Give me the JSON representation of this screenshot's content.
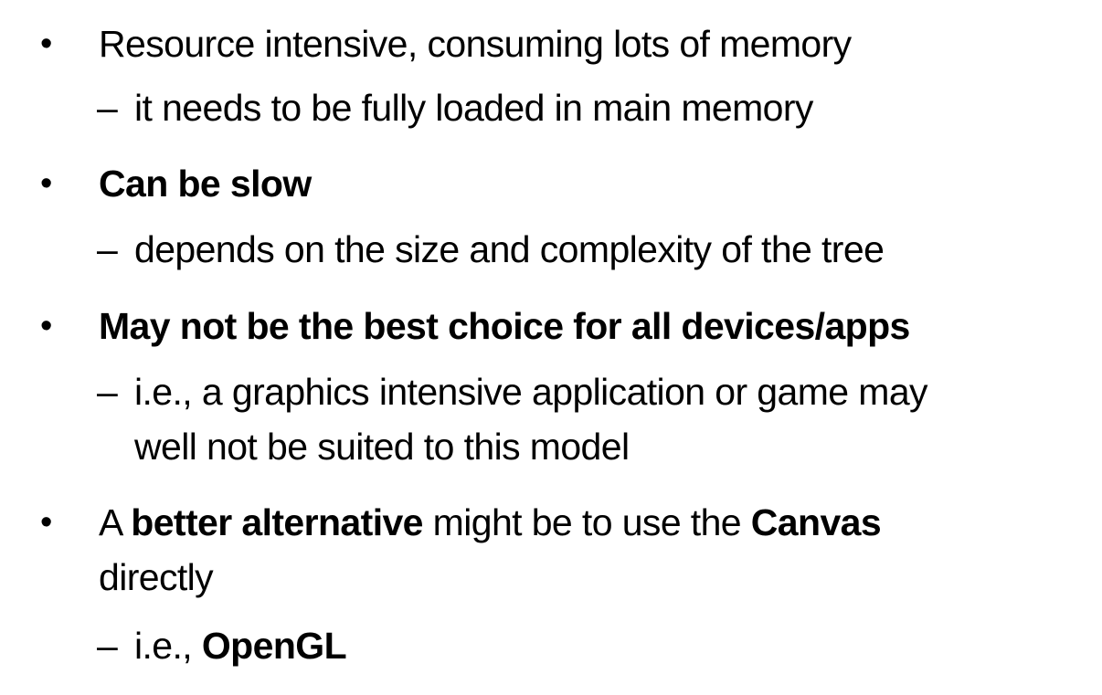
{
  "slide": {
    "bullet_glyph": "•",
    "dash_glyph": "–",
    "items": [
      {
        "text": "Resource intensive, consuming lots of memory",
        "sub": [
          "it needs to be fully loaded in main memory"
        ]
      },
      {
        "text": "Can be slow",
        "sub": [
          "depends on the size and complexity of the tree"
        ]
      },
      {
        "text": "May not be the best choice for all devices/apps",
        "sub": [
          "i.e., a graphics intensive application or game may",
          "well not be suited to this model"
        ]
      },
      {
        "text_parts": [
          "A ",
          "better alternative",
          " might be to use the ",
          "Canvas",
          "directly"
        ],
        "sub_parts": [
          "i.e., ",
          "OpenGL"
        ]
      }
    ]
  }
}
